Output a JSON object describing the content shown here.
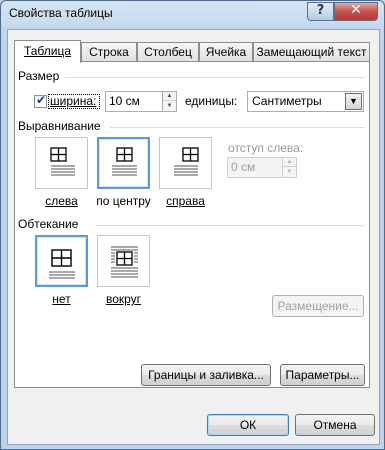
{
  "window": {
    "title": "Свойства таблицы",
    "help_glyph": "?",
    "close_glyph": "✕"
  },
  "tabs": [
    {
      "label": "Таблица",
      "active": true
    },
    {
      "label": "Строка"
    },
    {
      "label": "Столбец"
    },
    {
      "label": "Ячейка"
    },
    {
      "label": "Замещающий текст"
    }
  ],
  "size": {
    "group_title": "Размер",
    "width_checkbox_checked": true,
    "width_label": "ширина:",
    "width_value": "10 см",
    "units_label": "единицы:",
    "units_value": "Сантиметры"
  },
  "alignment": {
    "group_title": "Выравнивание",
    "options": [
      {
        "label": "слева",
        "selected": false
      },
      {
        "label": "по центру",
        "selected": true
      },
      {
        "label": "справа",
        "selected": false
      }
    ],
    "indent_label": "отступ слева:",
    "indent_value": "0 см"
  },
  "wrapping": {
    "group_title": "Обтекание",
    "options": [
      {
        "label": "нет",
        "selected": true
      },
      {
        "label": "вокруг",
        "selected": false
      }
    ],
    "placement_button": "Размещение..."
  },
  "buttons": {
    "borders": "Границы и заливка...",
    "options": "Параметры...",
    "ok": "ОК",
    "cancel": "Отмена"
  },
  "colors": {
    "selection_border": "#5b9bd5",
    "divider": "#d5dfe5"
  }
}
